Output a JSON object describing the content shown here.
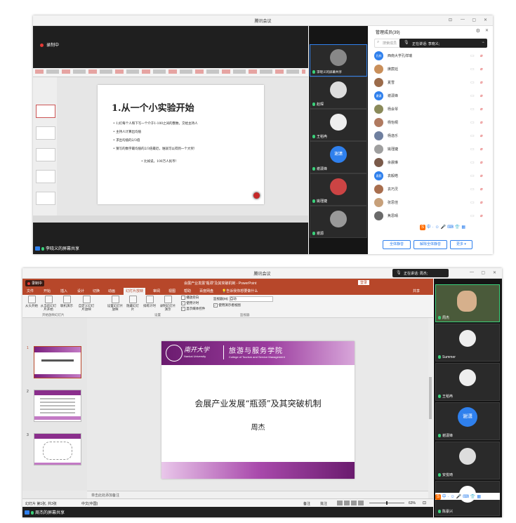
{
  "top": {
    "window_title": "腾讯会议",
    "recording": "录制中",
    "slide": {
      "title": "1.从一个小实验开始",
      "bullets": [
        "• 1)们每个人和下写一个介于1-100之间的整数，交给主持人",
        "• 主持人计算出均值",
        "• 求出均值的2/3倍",
        "• 猜写的数字最均值的2/3倍最近，谁就可以得到一个大奖!",
        "• 比如说，100万人民币！"
      ]
    },
    "share_label": "李晓义的屏幕共享",
    "videos": [
      {
        "name": "李晓义的屏幕共享"
      },
      {
        "name": "赵琛"
      },
      {
        "name": "王稻冉"
      },
      {
        "name": "谢潇锋",
        "initials": "谢潇"
      },
      {
        "name": "姚瑾婕"
      },
      {
        "name": "谢源"
      }
    ],
    "panel": {
      "title": "管理成员(39)",
      "search_placeholder": "搜索成员",
      "speaking": "正在讲话: 李晓义;",
      "members": [
        {
          "name": "西南大学孔祥瑞",
          "color": "#2f80ed",
          "initials": "孔祥"
        },
        {
          "name": "席宸廷",
          "color": "#c98f5a"
        },
        {
          "name": "夏雪",
          "color": "#9b6b4a"
        },
        {
          "name": "谢潇锋",
          "color": "#2f80ed",
          "initials": "谢潇"
        },
        {
          "name": "杨会琴",
          "color": "#8a8a5a"
        },
        {
          "name": "杨怡桐",
          "color": "#b07a60"
        },
        {
          "name": "杨逸乐",
          "color": "#6f7f9f"
        },
        {
          "name": "姚瑾婕",
          "color": "#9f9f9f"
        },
        {
          "name": "余晨琳",
          "color": "#7a5a4a"
        },
        {
          "name": "袁毅皓",
          "color": "#2f80ed",
          "initials": "袁毅"
        },
        {
          "name": "袁巧灵",
          "color": "#a86e4e"
        },
        {
          "name": "张思佳",
          "color": "#c7a07a"
        },
        {
          "name": "焦思晴",
          "color": "#6a6a6a"
        }
      ],
      "mute_all": "全体静音",
      "unmute_all": "解除全体静音",
      "more": "更多"
    }
  },
  "bottom": {
    "window_title": "腾讯会议",
    "speaking": "正在讲话: 周杰;",
    "recording": "录制中",
    "ppt_title": "会展产业发展“瓶颈”及其突破机制 - PowerPoint",
    "login": "登录",
    "tabs": [
      "文件",
      "开始",
      "插入",
      "设计",
      "切换",
      "动画",
      "幻灯片放映",
      "审阅",
      "视图",
      "帮助",
      "百度网盘"
    ],
    "tell_me": "告诉我你想要做什么",
    "share": "共享",
    "ribbon": {
      "groups": [
        "开始放映幻灯片",
        "设置",
        "监视器"
      ],
      "buttons": [
        "从头开始",
        "从当前幻灯片开始",
        "联机演示",
        "自定义幻灯片放映",
        "设置幻灯片放映",
        "隐藏幻灯片",
        "排练计时",
        "录制幻灯片演示"
      ],
      "checks": [
        "播放旁白",
        "使用计时",
        "显示媒体控件"
      ],
      "monitor": "监视器(M):",
      "monitor_value": "自动",
      "presenter_view": "使用演示者视图"
    },
    "slide": {
      "uni_name": "南开大学",
      "uni_en": "Nankai University",
      "college": "旅游与服务学院",
      "college_en": "College of Tourism and Service Management",
      "title": "会展产业发展“瓶颈”及其突破机制",
      "author": "周杰"
    },
    "notes": "单击此处添加备注",
    "status_left": "幻灯片 第1张, 共3张",
    "status_lang": "中文(中国)",
    "status_notes": "备注",
    "status_comments": "批注",
    "zoom": "63%",
    "share_label": "周杰的屏幕共享",
    "videos": [
      {
        "name": "周杰"
      },
      {
        "name": "Summer"
      },
      {
        "name": "王稻冉"
      },
      {
        "name": "谢潇锋",
        "initials": "谢潇"
      },
      {
        "name": "安悦琦"
      },
      {
        "name": "陈豪兴"
      }
    ]
  }
}
